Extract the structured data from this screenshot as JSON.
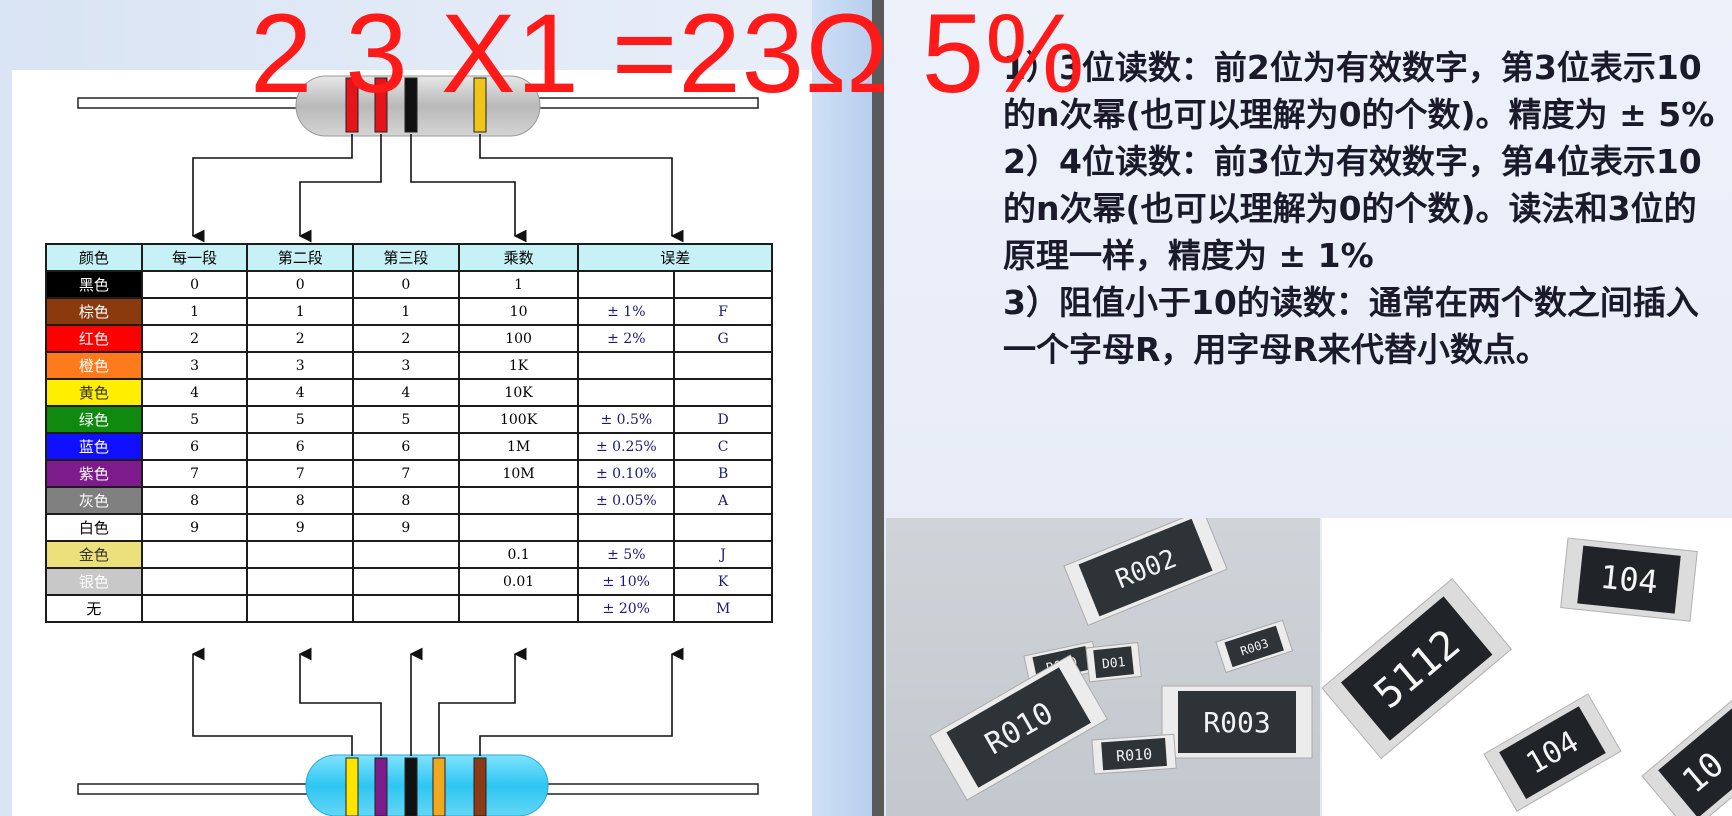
{
  "formula": "2 3 X1 =23Ω 5%",
  "table": {
    "headers": [
      "颜色",
      "每一段",
      "第二段",
      "第三段",
      "乘数",
      "误差"
    ],
    "rows": [
      {
        "color": "黑色",
        "bg": "#000000",
        "fg": "#ffffff",
        "d1": "0",
        "d2": "0",
        "d3": "0",
        "mult": "1",
        "tol": "",
        "code": ""
      },
      {
        "color": "棕色",
        "bg": "#8b3a0e",
        "fg": "#ffffff",
        "d1": "1",
        "d2": "1",
        "d3": "1",
        "mult": "10",
        "tol": "± 1%",
        "code": "F"
      },
      {
        "color": "红色",
        "bg": "#ff0000",
        "fg": "#ffffff",
        "d1": "2",
        "d2": "2",
        "d3": "2",
        "mult": "100",
        "tol": "± 2%",
        "code": "G"
      },
      {
        "color": "橙色",
        "bg": "#ff7a1a",
        "fg": "#ffffff",
        "d1": "3",
        "d2": "3",
        "d3": "3",
        "mult": "1K",
        "tol": "",
        "code": ""
      },
      {
        "color": "黄色",
        "bg": "#ffee00",
        "fg": "#333333",
        "d1": "4",
        "d2": "4",
        "d3": "4",
        "mult": "10K",
        "tol": "",
        "code": ""
      },
      {
        "color": "绿色",
        "bg": "#0f8a0f",
        "fg": "#ffffff",
        "d1": "5",
        "d2": "5",
        "d3": "5",
        "mult": "100K",
        "tol": "± 0.5%",
        "code": "D"
      },
      {
        "color": "蓝色",
        "bg": "#1010ff",
        "fg": "#ffffff",
        "d1": "6",
        "d2": "6",
        "d3": "6",
        "mult": "1M",
        "tol": "± 0.25%",
        "code": "C"
      },
      {
        "color": "紫色",
        "bg": "#7d1a8c",
        "fg": "#ffffff",
        "d1": "7",
        "d2": "7",
        "d3": "7",
        "mult": "10M",
        "tol": "± 0.10%",
        "code": "B"
      },
      {
        "color": "灰色",
        "bg": "#808080",
        "fg": "#ffffff",
        "d1": "8",
        "d2": "8",
        "d3": "8",
        "mult": "",
        "tol": "± 0.05%",
        "code": "A"
      },
      {
        "color": "白色",
        "bg": "#ffffff",
        "fg": "#000000",
        "d1": "9",
        "d2": "9",
        "d3": "9",
        "mult": "",
        "tol": "",
        "code": ""
      },
      {
        "color": "金色",
        "bg": "#ece07a",
        "fg": "#333333",
        "d1": "",
        "d2": "",
        "d3": "",
        "mult": "0.1",
        "tol": "± 5%",
        "code": "J"
      },
      {
        "color": "银色",
        "bg": "#c8c8c8",
        "fg": "#ffffff",
        "d1": "",
        "d2": "",
        "d3": "",
        "mult": "0.01",
        "tol": "± 10%",
        "code": "K"
      },
      {
        "color": "无",
        "bg": "#ffffff",
        "fg": "#000000",
        "d1": "",
        "d2": "",
        "d3": "",
        "mult": "",
        "tol": "± 20%",
        "code": "M"
      }
    ]
  },
  "explanation": [
    "1）3位读数：前2位为有效数字，第3位表示10的n次幂(也可以理解为0的个数)。精度为 ± 5%",
    "2）4位读数：前3位为有效数字，第4位表示10的n次幂(也可以理解为0的个数)。读法和3位的原理一样，精度为 ± 1%",
    "3）阻值小于10的读数：通常在两个数之间插入一个字母R，用字母R来代替小数点。"
  ],
  "photo_left_labels": [
    "R002",
    "R010",
    "R010",
    "R003",
    "R010",
    "D01",
    "R003"
  ],
  "photo_right_labels": [
    "5112",
    "104",
    "104",
    "10"
  ]
}
